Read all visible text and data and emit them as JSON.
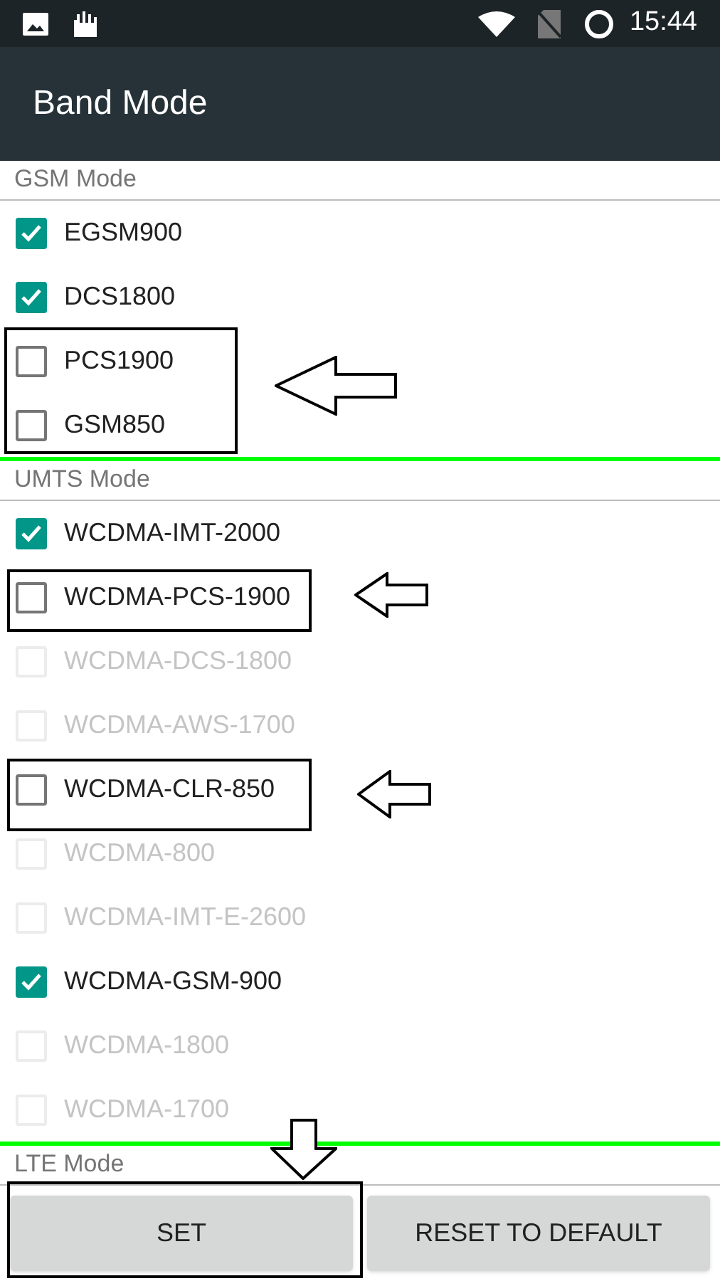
{
  "status_bar": {
    "time": "15:44"
  },
  "app_bar": {
    "title": "Band Mode"
  },
  "sections": [
    {
      "title": "GSM Mode",
      "items": [
        {
          "label": "EGSM900",
          "checked": true,
          "disabled": false
        },
        {
          "label": "DCS1800",
          "checked": true,
          "disabled": false
        },
        {
          "label": "PCS1900",
          "checked": false,
          "disabled": false
        },
        {
          "label": "GSM850",
          "checked": false,
          "disabled": false
        }
      ]
    },
    {
      "title": "UMTS Mode",
      "items": [
        {
          "label": "WCDMA-IMT-2000",
          "checked": true,
          "disabled": false
        },
        {
          "label": "WCDMA-PCS-1900",
          "checked": false,
          "disabled": false
        },
        {
          "label": "WCDMA-DCS-1800",
          "checked": false,
          "disabled": true
        },
        {
          "label": "WCDMA-AWS-1700",
          "checked": false,
          "disabled": true
        },
        {
          "label": "WCDMA-CLR-850",
          "checked": false,
          "disabled": false
        },
        {
          "label": "WCDMA-800",
          "checked": false,
          "disabled": true
        },
        {
          "label": "WCDMA-IMT-E-2600",
          "checked": false,
          "disabled": true
        },
        {
          "label": "WCDMA-GSM-900",
          "checked": true,
          "disabled": false
        },
        {
          "label": "WCDMA-1800",
          "checked": false,
          "disabled": true
        },
        {
          "label": "WCDMA-1700",
          "checked": false,
          "disabled": true
        }
      ]
    },
    {
      "title": "LTE Mode"
    }
  ],
  "buttons": [
    "SET",
    "RESET TO DEFAULT"
  ]
}
